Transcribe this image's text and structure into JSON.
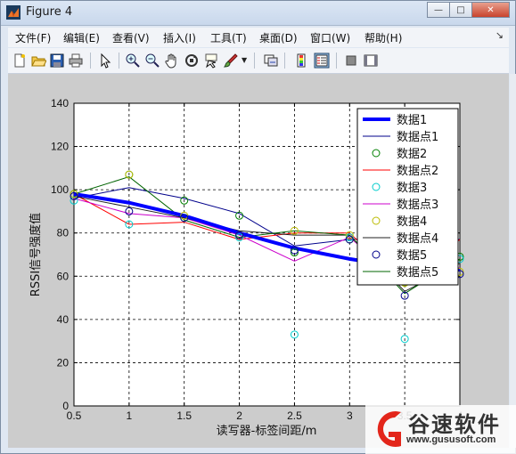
{
  "window": {
    "title": "Figure 4",
    "buttons": {
      "minimize": "—",
      "maximize": "□",
      "close": "✕"
    }
  },
  "menu": {
    "items": [
      "文件(F)",
      "编辑(E)",
      "查看(V)",
      "插入(I)",
      "工具(T)",
      "桌面(D)",
      "窗口(W)",
      "帮助(H)"
    ]
  },
  "toolbar": {
    "icons": [
      "new-figure-icon",
      "open-file-icon",
      "save-icon",
      "print-icon",
      "pointer-icon",
      "zoom-in-icon",
      "zoom-out-icon",
      "pan-hand-icon",
      "rotate-3d-icon",
      "data-cursor-icon",
      "brush-icon",
      "brush-dropdown-icon",
      "link-plot-icon",
      "colorbar-icon",
      "legend-icon",
      "hide-plot-tools-icon",
      "show-plot-tools-icon"
    ]
  },
  "watermark": {
    "text": "谷速软件",
    "url": "www.gususoft.com"
  },
  "chart_data": {
    "type": "line",
    "xlabel": "读写器-标签间距/m",
    "ylabel": "RSSI信号强度值",
    "xlim": [
      0.5,
      4
    ],
    "ylim": [
      0,
      140
    ],
    "xticks": [
      "0.5",
      "1",
      "1.5",
      "2",
      "2.5",
      "3",
      "3.5",
      "4"
    ],
    "yticks": [
      "0",
      "20",
      "40",
      "60",
      "80",
      "100",
      "120",
      "140"
    ],
    "grid": true,
    "legend_position": "top-right",
    "x": [
      0.5,
      1,
      1.5,
      2,
      2.5,
      3,
      3.5,
      4
    ],
    "series": [
      {
        "name": "数据1",
        "color": "#0000ff",
        "style": "thick-line",
        "values": [
          98,
          94,
          88,
          80,
          73,
          68,
          64,
          63
        ]
      },
      {
        "name": "数据点1",
        "color": "#00008b",
        "style": "line",
        "values": [
          96,
          101,
          96,
          89,
          74,
          77,
          78,
          77
        ]
      },
      {
        "name": "数据2",
        "color": "#008000",
        "style": "marker",
        "values": [
          98,
          107,
          95,
          88,
          71,
          77,
          57,
          69
        ]
      },
      {
        "name": "数据点2",
        "color": "#ff0000",
        "style": "line",
        "values": [
          98,
          84,
          85,
          77,
          80,
          80,
          56,
          77
        ]
      },
      {
        "name": "数据3",
        "color": "#00cccc",
        "style": "marker",
        "values": [
          95,
          84,
          87,
          78,
          33,
          78,
          31,
          68
        ]
      },
      {
        "name": "数据点3",
        "color": "#cc00cc",
        "style": "line",
        "values": [
          96,
          89,
          87,
          79,
          67,
          78,
          56,
          64
        ]
      },
      {
        "name": "数据4",
        "color": "#bbbb00",
        "style": "marker",
        "values": [
          98,
          107,
          88,
          79,
          81,
          79,
          57,
          62
        ]
      },
      {
        "name": "数据点4",
        "color": "#222222",
        "style": "line",
        "values": [
          97,
          92,
          87,
          81,
          79,
          79,
          53,
          66
        ]
      },
      {
        "name": "数据5",
        "color": "#00008b",
        "style": "marker",
        "values": [
          97,
          90,
          87,
          79,
          72,
          77,
          51,
          61
        ]
      },
      {
        "name": "数据点5",
        "color": "#006400",
        "style": "line",
        "values": [
          98,
          106,
          86,
          78,
          81,
          79,
          52,
          68
        ]
      }
    ]
  }
}
